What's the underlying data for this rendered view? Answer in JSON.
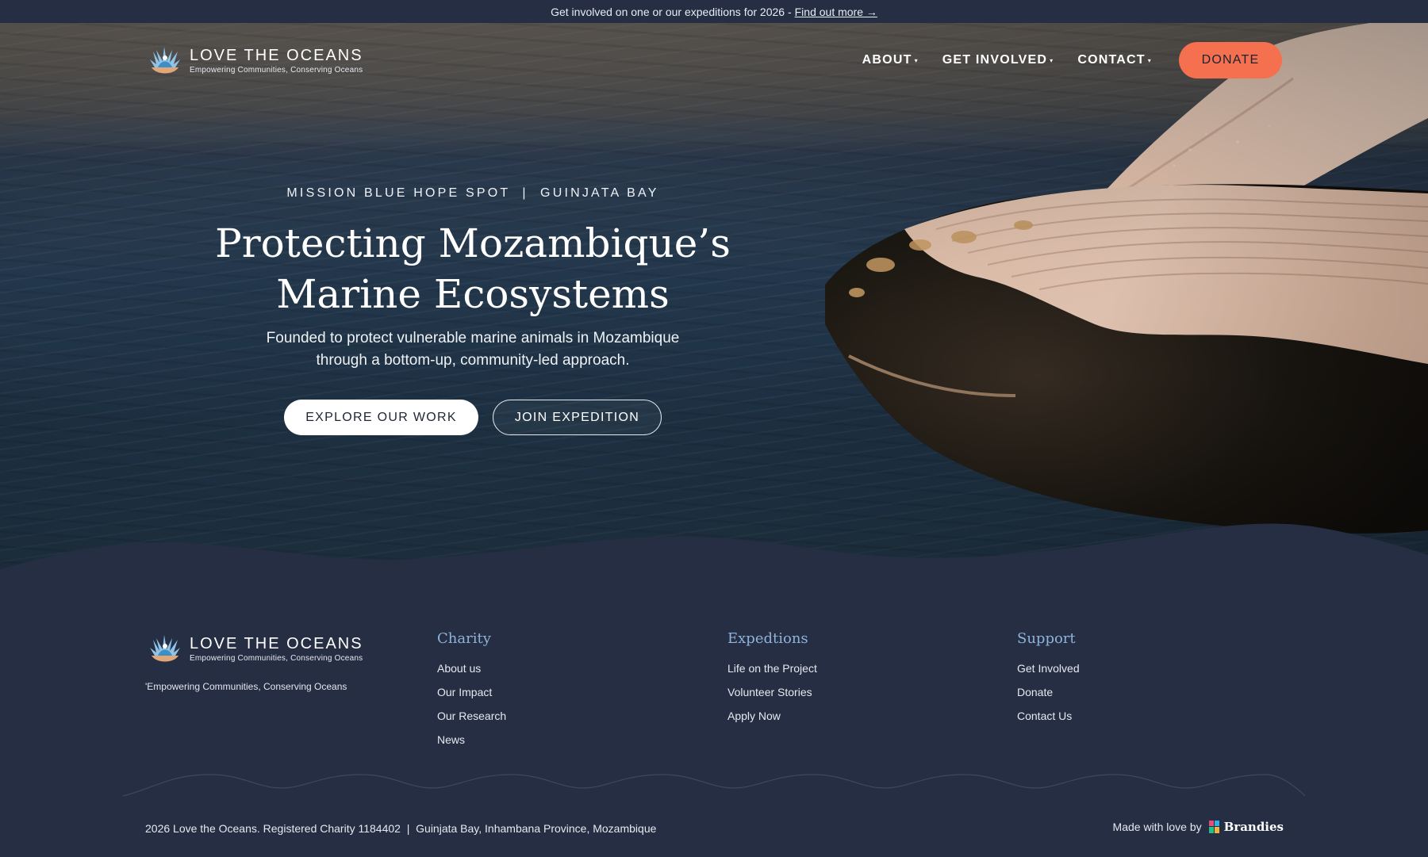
{
  "announcement": {
    "text": "Get involved on one or our expeditions for 2026 -",
    "link": "Find out more →"
  },
  "brand": {
    "name": "LOVE THE OCEANS",
    "tagline": "Empowering Communities, Conserving Oceans"
  },
  "nav": {
    "items": [
      {
        "label": "ABOUT"
      },
      {
        "label": "GET INVOLVED"
      },
      {
        "label": "CONTACT"
      }
    ],
    "caret": "▾",
    "donate": "DONATE"
  },
  "hero": {
    "eyebrow": "MISSION BLUE HOPE SPOT  |  GUINJATA BAY",
    "headline_line1": "Protecting Mozambique’s",
    "headline_line2": "Marine Ecosystems",
    "sub_line1": "Founded to protect vulnerable marine animals in Mozambique",
    "sub_line2": "through a bottom-up, community-led approach.",
    "cta_primary": "EXPLORE OUR WORK",
    "cta_secondary": "JOIN EXPEDITION"
  },
  "footer": {
    "tagline": "'Empowering Communities, Conserving Oceans",
    "columns": [
      {
        "title": "Charity",
        "links": [
          "About us",
          "Our Impact",
          "Our Research",
          "News"
        ]
      },
      {
        "title": "Expedtions",
        "links": [
          "Life on the Project",
          "Volunteer Stories",
          "Apply Now"
        ]
      },
      {
        "title": "Support",
        "links": [
          "Get Involved",
          "Donate",
          "Contact Us"
        ]
      }
    ],
    "copyright": "2026 Love the Oceans. Registered Charity 1184402  |  Guinjata Bay, Inhambana Province, Mozambique",
    "made_by_prefix": "Made with love by",
    "made_by_name": "Brandies"
  },
  "colors": {
    "navy": "#252e43",
    "accent_orange": "#f5704f",
    "footer_heading": "#8fb3db"
  }
}
